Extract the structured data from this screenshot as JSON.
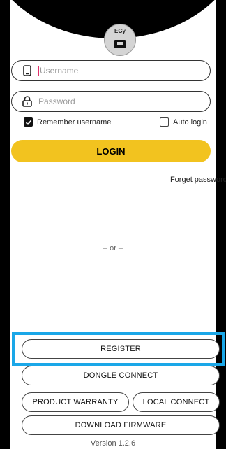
{
  "login": {
    "logo_text": "EGy",
    "username_placeholder": "Username",
    "password_placeholder": "Password",
    "remember_label": "Remember username",
    "remember_checked": true,
    "auto_login_label": "Auto login",
    "auto_login_checked": false,
    "login_button": "LOGIN",
    "forget_password": "Forget password?",
    "or_separator": "– or –"
  },
  "actions": {
    "register": "REGISTER",
    "dongle_connect": "DONGLE CONNECT",
    "product_warranty": "PRODUCT WARRANTY",
    "local_connect": "LOCAL CONNECT",
    "download_firmware": "DOWNLOAD FIRMWARE"
  },
  "footer": {
    "version": "Version 1.2.6"
  },
  "colors": {
    "accent": "#f2c31f",
    "highlight": "#1aa7e8",
    "background": "#000000"
  },
  "icons": {
    "username": "phone-icon",
    "password": "lock-icon"
  }
}
